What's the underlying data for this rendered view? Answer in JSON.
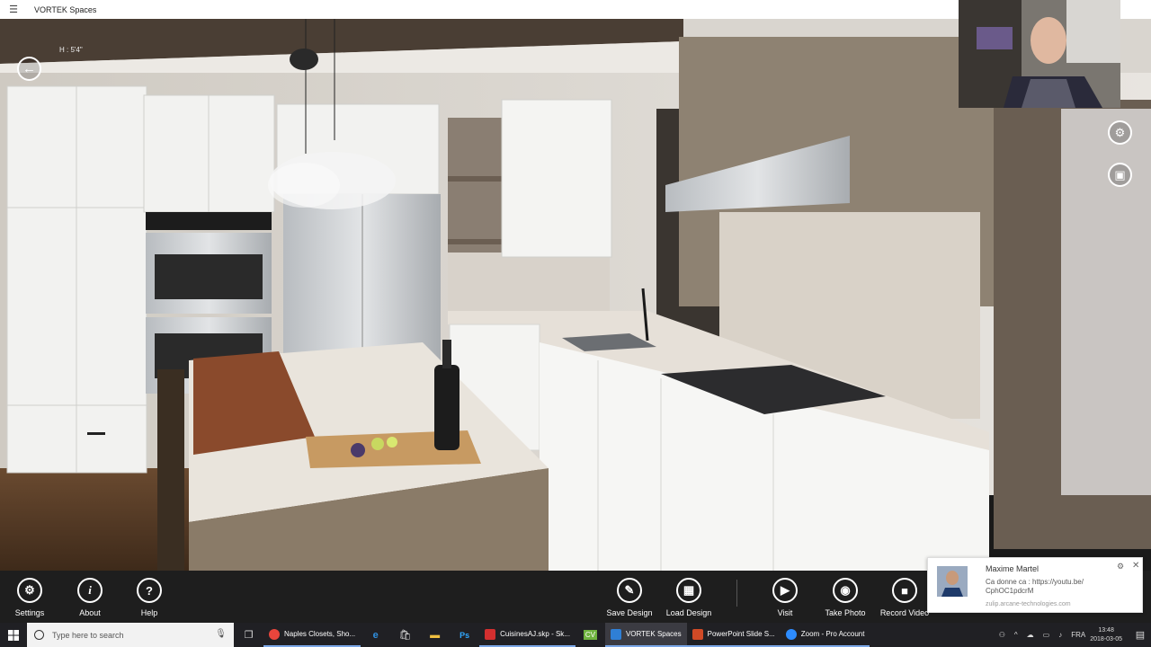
{
  "window": {
    "title": "VORTEK Spaces",
    "menu_icon": "hamburger-icon"
  },
  "hud": {
    "height_readout": "H : 5'4\""
  },
  "side_buttons": [
    {
      "name": "settings-gear",
      "icon": "gear-icon"
    },
    {
      "name": "gallery",
      "icon": "image-icon"
    }
  ],
  "appbar": {
    "left": [
      {
        "id": "settings",
        "label": "Settings",
        "glyph": "⚙"
      },
      {
        "id": "about",
        "label": "About",
        "glyph": "i"
      },
      {
        "id": "help",
        "label": "Help",
        "glyph": "?"
      }
    ],
    "right": [
      {
        "id": "save-design",
        "label": "Save Design",
        "glyph": "✎"
      },
      {
        "id": "load-design",
        "label": "Load Design",
        "glyph": "▦"
      },
      {
        "id": "visit",
        "label": "Visit",
        "glyph": "▶"
      },
      {
        "id": "take-photo",
        "label": "Take Photo",
        "glyph": "◉"
      },
      {
        "id": "record-video",
        "label": "Record Video",
        "glyph": "■"
      }
    ]
  },
  "notification": {
    "name": "Maxime Martel",
    "line1": "Ca donne ca : https://youtu.be/",
    "line2": "CphOC1pdcrM",
    "source": "zulip.arcane-technologies.com"
  },
  "taskbar": {
    "search_placeholder": "Type here to search",
    "apps": [
      {
        "label": "Naples Closets, Sho...",
        "color": "#e8453c"
      },
      {
        "label": "CuisinesAJ.skp - Sk...",
        "color": "#d32f2f"
      },
      {
        "label": "VORTEK Spaces",
        "color": "#2f7fd6",
        "active": true
      },
      {
        "label": "PowerPoint Slide S...",
        "color": "#d04a26"
      },
      {
        "label": "Zoom - Pro Account",
        "color": "#2d8cff"
      }
    ],
    "language": "FRA",
    "time": "13:48",
    "date": "2018-03-05"
  },
  "colors": {
    "appbar_bg": "#1e1e1e",
    "accent": "#7aa6e6"
  }
}
